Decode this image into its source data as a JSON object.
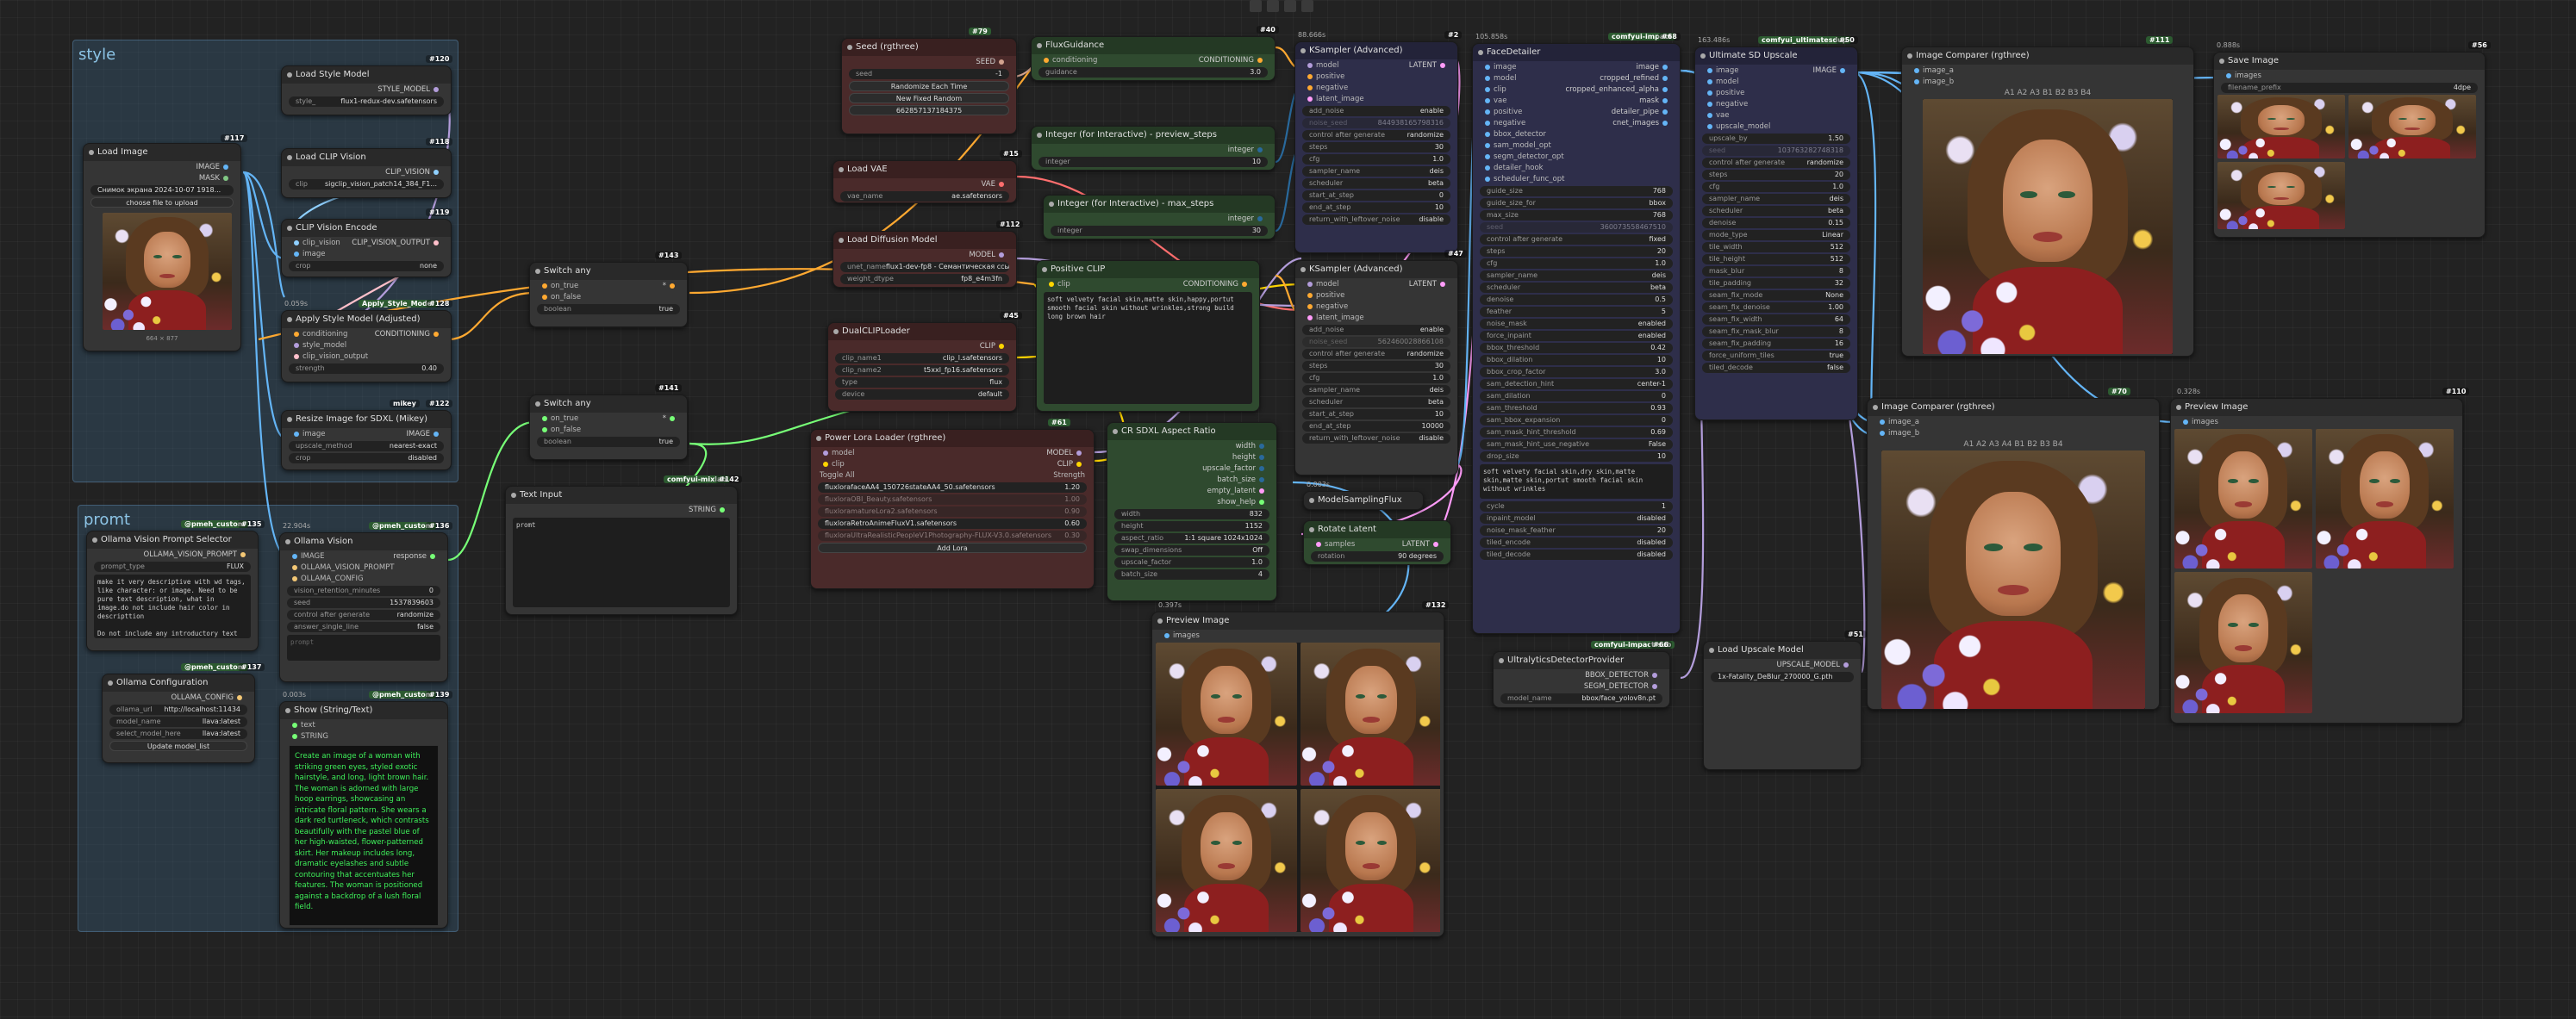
{
  "groups": {
    "style": "style",
    "promt": "promt"
  },
  "nodes": {
    "load_style_model": {
      "title": "Load Style Model",
      "id": "#120",
      "output": "STYLE_MODEL",
      "widget_label": "style_",
      "widget_value": "flux1-redux-dev.safetensors"
    },
    "load_image": {
      "title": "Load Image",
      "id": "#117",
      "out1": "IMAGE",
      "out2": "MASK",
      "file_value": "Снимок экрана 2024-10-07 1918...",
      "upload_label": "choose file to upload",
      "caption": "664 × 877"
    },
    "load_clip_vision": {
      "title": "Load CLIP Vision",
      "id": "#118",
      "output": "CLIP_VISION",
      "widget_label": "clip",
      "widget_value": "sigclip_vision_patch14_384_F1..."
    },
    "clip_vision_encode": {
      "title": "CLIP Vision Encode",
      "id": "#119",
      "in1": "clip_vision",
      "in2": "image",
      "output": "CLIP_VISION_OUTPUT",
      "widget_label": "crop",
      "widget_value": "none"
    },
    "apply_style_model": {
      "title": "Apply Style Model (Adjusted)",
      "id": "#128",
      "tag": "Apply_Style_Model",
      "time": "0.059s",
      "in1": "conditioning",
      "in2": "style_model",
      "in3": "clip_vision_output",
      "output": "CONDITIONING",
      "widget_label": "strength",
      "widget_value": "0.40"
    },
    "resize_image": {
      "title": "Resize Image for SDXL (Mikey)",
      "id": "#122",
      "tag": "mikey",
      "in1": "image",
      "output": "IMAGE",
      "w1_label": "upscale_method",
      "w1_value": "nearest-exact",
      "w2_label": "crop",
      "w2_value": "disabled"
    },
    "seed": {
      "title": "Seed (rgthree)",
      "id": "#79",
      "tag": "rgthree",
      "output": "SEED",
      "seed_label": "seed",
      "seed_value": "-1",
      "btn1": "Randomize Each Time",
      "btn2": "New Fixed Random",
      "btn3": "662857137184375"
    },
    "load_vae": {
      "title": "Load VAE",
      "id": "#15",
      "output": "VAE",
      "widget_label": "vae_name",
      "widget_value": "ae.safetensors"
    },
    "load_diffusion_model": {
      "title": "Load Diffusion Model",
      "id": "#112",
      "output": "MODEL",
      "w1_label": "unet_name",
      "w1_value": "flux1-dev-fp8 - Семантическая ссылка",
      "w2_label": "weight_dtype",
      "w2_value": "fp8_e4m3fn"
    },
    "dualclip_loader": {
      "title": "DualCLIPLoader",
      "id": "#45",
      "output": "CLIP",
      "w1_label": "clip_name1",
      "w1_value": "clip_l.safetensors",
      "w2_label": "clip_name2",
      "w2_value": "t5xxl_fp16.safetensors",
      "w3_label": "type",
      "w3_value": "flux",
      "w4_label": "device",
      "w4_value": "default"
    },
    "power_lora": {
      "title": "Power Lora Loader (rgthree)",
      "id": "#61",
      "tag": "rgthree",
      "in1": "model",
      "in2": "clip",
      "out1": "MODEL",
      "out2": "CLIP",
      "toggle_label": "Toggle All",
      "strength_label": "Strength",
      "loras": [
        {
          "name": "fluxlorafaceAA4_150726stateAA4_50.safetensors",
          "value": "1.20"
        },
        {
          "name": "fluxloraOBI_Beauty.safetensors",
          "value": "1.00"
        },
        {
          "name": "fluxloramatureLora2.safetensors",
          "value": "0.90"
        },
        {
          "name": "fluxloraRetroAnimeFluxV1.safetensors",
          "value": "0.60"
        },
        {
          "name": "fluxloraUltraRealisticPeopleV1Photography-FLUX-V3.0.safetensors",
          "value": "0.30"
        }
      ],
      "add_label": "Add Lora"
    },
    "switch_any_1": {
      "title": "Switch any",
      "id": "#143",
      "tag": "Cr",
      "in1": "on_true",
      "in2": "on_false",
      "out": "*",
      "w_label": "boolean",
      "w_value": "true"
    },
    "switch_any_2": {
      "title": "Switch any",
      "id": "#141",
      "tag": "Cr",
      "in1": "on_true",
      "in2": "on_false",
      "out": "*",
      "w_label": "boolean",
      "w_value": "true"
    },
    "text_input": {
      "title": "Text Input",
      "id": "#142",
      "tag": "comfyui-mixlab",
      "output": "STRING",
      "text": "promt"
    },
    "ollama_vision": {
      "title": "Ollama Vision Prompt Selector",
      "id": "#135",
      "tag": "@pmeh_custom",
      "out1": "OLLAMA_VISION_PROMPT",
      "w1_label": "prompt_type",
      "w1_value": "FLUX",
      "text": "make it very descriptive with wd tags, like character: or image. Need to be pure text description, what in image.do not include hair color in descripttion\n\nDo not include any introductory text or explanations, make it a clean one line answer.",
      "time": "22.904s"
    },
    "ollama_config": {
      "title": "Ollama Configuration",
      "id": "#137",
      "tag": "@pmeh_custom",
      "output": "OLLAMA_CONFIG",
      "w1_label": "ollama_url",
      "w1_value": "http://localhost:11434",
      "w2_label": "model_name",
      "w2_value": "llava:latest",
      "w3_label": "select_model_here",
      "w3_value": "llava:latest",
      "btn": "Update model_list"
    },
    "ollama_vision_node": {
      "title": "Ollama Vision",
      "id": "#136",
      "tag": "@pmeh_custom",
      "in1": "IMAGE",
      "in2": "OLLAMA_VISION_PROMPT",
      "in3": "OLLAMA_CONFIG",
      "output": "response",
      "w1_label": "vision_retention_minutes",
      "w1_value": "0",
      "w2_label": "seed",
      "w2_value": "1537839603",
      "w3_label": "control after generate",
      "w3_value": "randomize",
      "w4_label": "answer_single_line",
      "w4_value": "false",
      "ta_label": "prompt"
    },
    "show_text": {
      "title": "Show (String/Text)",
      "id": "#139",
      "tag": "@pmeh_custom",
      "time": "0.003s",
      "in1": "text",
      "output": "STRING",
      "text": "Create an image of a woman with striking green eyes, styled exotic hairstyle, and long, light brown hair. The woman is adorned with large hoop earrings, showcasing an intricate floral pattern. She wears a dark red turtleneck, which contrasts beautifully with the pastel blue of her high-waisted, flower-patterned skirt. Her makeup includes long, dramatic eyelashes and subtle contouring that accentuates her features.\n\nThe woman is positioned against a backdrop of a lush floral field."
    },
    "flux_guidance": {
      "title": "FluxGuidance",
      "id": "#40",
      "in1": "conditioning",
      "output": "CONDITIONING",
      "w_label": "guidance",
      "w_value": "3.0"
    },
    "int_preview": {
      "title": "Integer (for Interactive) - preview_steps",
      "id": "#107",
      "output": "integer",
      "w_label": "integer",
      "w_value": "10"
    },
    "int_max": {
      "title": "Integer (for Interactive) - max_steps",
      "id": "#108",
      "output": "integer",
      "w_label": "integer",
      "w_value": "30"
    },
    "positive_clip": {
      "title": "Positive CLIP",
      "id": "#65",
      "in1": "clip",
      "output": "CONDITIONING",
      "text": "soft velvety facial skin,matte skin,happy,portut smooth facial skin without wrinkles,strong build long brown hair"
    },
    "cr_sdxl_aspect": {
      "title": "CR SDXL Aspect Ratio",
      "id": "#113",
      "out1": "width",
      "out2": "height",
      "out3": "upscale_factor",
      "out4": "batch_size",
      "out5": "empty_latent",
      "out6": "show_help",
      "w1_label": "width",
      "w1_value": "832",
      "w2_label": "height",
      "w2_value": "1152",
      "w3_label": "aspect_ratio",
      "w3_value": "1:1 square 1024x1024",
      "w4_label": "swap_dimensions",
      "w4_value": "Off",
      "w5_label": "upscale_factor",
      "w5_value": "1.0",
      "w6_label": "batch_size",
      "w6_value": "4"
    },
    "ksampler_1": {
      "title": "KSampler (Advanced)",
      "id": "#2",
      "time": "88.666s",
      "in1": "model",
      "in2": "positive",
      "in3": "negative",
      "in4": "latent_image",
      "output": "LATENT",
      "widgets": [
        {
          "l": "add_noise",
          "v": "enable"
        },
        {
          "l": "noise_seed",
          "v": "844938165798316"
        },
        {
          "l": "control after generate",
          "v": "randomize"
        },
        {
          "l": "steps",
          "v": "30"
        },
        {
          "l": "cfg",
          "v": "1.0"
        },
        {
          "l": "sampler_name",
          "v": "deis"
        },
        {
          "l": "scheduler",
          "v": "beta"
        },
        {
          "l": "start_at_step",
          "v": "0"
        },
        {
          "l": "end_at_step",
          "v": "10"
        },
        {
          "l": "return_with_leftover_noise",
          "v": "disable"
        }
      ]
    },
    "ksampler_2": {
      "title": "KSampler (Advanced)",
      "id": "#47",
      "in1": "model",
      "in2": "positive",
      "in3": "negative",
      "in4": "latent_image",
      "output": "LATENT",
      "widgets": [
        {
          "l": "add_noise",
          "v": "enable"
        },
        {
          "l": "noise_seed",
          "v": "562460028866108"
        },
        {
          "l": "control after generate",
          "v": "randomize"
        },
        {
          "l": "steps",
          "v": "30"
        },
        {
          "l": "cfg",
          "v": "1.0"
        },
        {
          "l": "sampler_name",
          "v": "deis"
        },
        {
          "l": "scheduler",
          "v": "beta"
        },
        {
          "l": "start_at_step",
          "v": "10"
        },
        {
          "l": "end_at_step",
          "v": "10000"
        },
        {
          "l": "return_with_leftover_noise",
          "v": "disable"
        }
      ]
    },
    "model_sampling": {
      "title": "ModelSamplingFlux",
      "time": "0.003s"
    },
    "rotate_latent": {
      "title": "Rotate Latent",
      "in1": "samples",
      "output": "LATENT",
      "w_label": "rotation",
      "w_value": "90 degrees"
    },
    "preview_image_1": {
      "title": "Preview Image",
      "id": "#132",
      "time": "0.397s",
      "in1": "images"
    },
    "face_detailer": {
      "title": "FaceDetailer",
      "id": "#68",
      "tag": "comfyui-impact",
      "time": "105.858s",
      "inputs": [
        "image",
        "model",
        "clip",
        "vae",
        "positive",
        "negative",
        "bbox_detector",
        "sam_model_opt",
        "segm_detector_opt",
        "detailer_hook",
        "scheduler_func_opt"
      ],
      "outputs": [
        "image",
        "cropped_refined",
        "cropped_enhanced_alpha",
        "mask",
        "detailer_pipe",
        "cnet_images"
      ],
      "widgets": [
        {
          "l": "guide_size",
          "v": "768"
        },
        {
          "l": "guide_size_for",
          "v": "bbox"
        },
        {
          "l": "max_size",
          "v": "768"
        },
        {
          "l": "seed",
          "v": "360073558467510"
        },
        {
          "l": "control after generate",
          "v": "fixed"
        },
        {
          "l": "steps",
          "v": "20"
        },
        {
          "l": "cfg",
          "v": "1.0"
        },
        {
          "l": "sampler_name",
          "v": "deis"
        },
        {
          "l": "scheduler",
          "v": "beta"
        },
        {
          "l": "denoise",
          "v": "0.5"
        },
        {
          "l": "feather",
          "v": "5"
        },
        {
          "l": "noise_mask",
          "v": "enabled"
        },
        {
          "l": "force_inpaint",
          "v": "enabled"
        },
        {
          "l": "bbox_threshold",
          "v": "0.42"
        },
        {
          "l": "bbox_dilation",
          "v": "10"
        },
        {
          "l": "bbox_crop_factor",
          "v": "3.0"
        },
        {
          "l": "sam_detection_hint",
          "v": "center-1"
        },
        {
          "l": "sam_dilation",
          "v": "0"
        },
        {
          "l": "sam_threshold",
          "v": "0.93"
        },
        {
          "l": "sam_bbox_expansion",
          "v": "0"
        },
        {
          "l": "sam_mask_hint_threshold",
          "v": "0.69"
        },
        {
          "l": "sam_mask_hint_use_negative",
          "v": "False"
        },
        {
          "l": "drop_size",
          "v": "10"
        }
      ],
      "text": "soft velvety facial skin,dry skin,matte skin,matte skin,portut smooth facial skin without wrinkles",
      "widgets2": [
        {
          "l": "cycle",
          "v": "1"
        },
        {
          "l": "inpaint_model",
          "v": "disabled"
        },
        {
          "l": "noise_mask_feather",
          "v": "20"
        },
        {
          "l": "tiled_encode",
          "v": "disabled"
        },
        {
          "l": "tiled_decode",
          "v": "disabled"
        }
      ]
    },
    "ultra_detector": {
      "title": "UltralyticsDetectorProvider",
      "id": "#66",
      "tag": "comfyui-impact-sub",
      "out1": "BBOX_DETECTOR",
      "out2": "SEGM_DETECTOR",
      "w_label": "model_name",
      "w_value": "bbox/face_yolov8n.pt"
    },
    "ultimate_sd": {
      "title": "Ultimate SD Upscale",
      "id": "#50",
      "tag": "comfyui_ultimatesdup",
      "time": "163.486s",
      "inputs": [
        "image",
        "model",
        "positive",
        "negative",
        "vae",
        "upscale_model"
      ],
      "output": "IMAGE",
      "widgets": [
        {
          "l": "upscale_by",
          "v": "1.50"
        },
        {
          "l": "seed",
          "v": "103763282748318"
        },
        {
          "l": "control after generate",
          "v": "randomize"
        },
        {
          "l": "steps",
          "v": "20"
        },
        {
          "l": "cfg",
          "v": "1.0"
        },
        {
          "l": "sampler_name",
          "v": "deis"
        },
        {
          "l": "scheduler",
          "v": "beta"
        },
        {
          "l": "denoise",
          "v": "0.15"
        },
        {
          "l": "mode_type",
          "v": "Linear"
        },
        {
          "l": "tile_width",
          "v": "512"
        },
        {
          "l": "tile_height",
          "v": "512"
        },
        {
          "l": "mask_blur",
          "v": "8"
        },
        {
          "l": "tile_padding",
          "v": "32"
        },
        {
          "l": "seam_fix_mode",
          "v": "None"
        },
        {
          "l": "seam_fix_denoise",
          "v": "1.00"
        },
        {
          "l": "seam_fix_width",
          "v": "64"
        },
        {
          "l": "seam_fix_mask_blur",
          "v": "8"
        },
        {
          "l": "seam_fix_padding",
          "v": "16"
        },
        {
          "l": "force_uniform_tiles",
          "v": "true"
        },
        {
          "l": "tiled_decode",
          "v": "false"
        }
      ]
    },
    "load_upscale": {
      "title": "Load Upscale Model",
      "id": "#51",
      "output": "UPSCALE_MODEL",
      "w_value": "1x-Fatality_DeBlur_270000_G.pth"
    },
    "image_comparer_1": {
      "title": "Image Comparer (rgthree)",
      "id": "#111",
      "tag": "rgthree",
      "in1": "image_a",
      "in2": "image_b",
      "labels": "A1 A2 A3 B1 B2 B3 B4"
    },
    "image_comparer_2": {
      "title": "Image Comparer (rgthree)",
      "id": "#70",
      "tag": "rgthree",
      "in1": "image_a",
      "in2": "image_b",
      "labels": "A1 A2 A3 A4 B1 B2 B3 B4"
    },
    "save_image": {
      "title": "Save Image",
      "id": "#56",
      "time": "0.888s",
      "in1": "images",
      "w_label": "filename_prefix",
      "w_value": "4dpe"
    },
    "preview_image_2": {
      "title": "Preview Image",
      "id": "#110",
      "time": "0.328s",
      "in1": "images"
    }
  },
  "colors": {
    "group_style": "#2a3e4f",
    "group_promt": "#2a3e4f",
    "node_green": "#2f4a2f",
    "node_red": "#4a2a2a",
    "node_purple": "#2e2e4a",
    "node_default": "#353535",
    "wire_conditioning": "#ffa931",
    "wire_model": "#b39ddb",
    "wire_clip": "#ffd500",
    "wire_image": "#64b5f6",
    "wire_latent": "#ff9cf9",
    "wire_vae": "#ff6e6e",
    "wire_int": "#29699c",
    "wire_string": "#77ff77",
    "text_green": "#3ef05a"
  }
}
